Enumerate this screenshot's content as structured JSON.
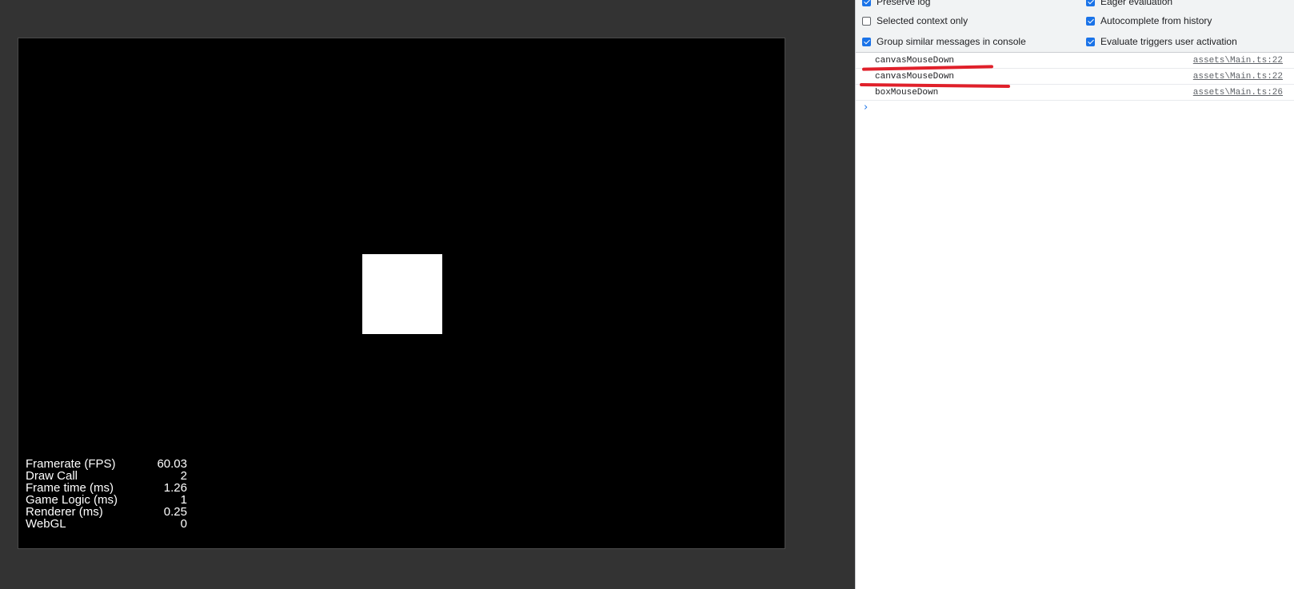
{
  "stats": [
    {
      "label": "Framerate (FPS)",
      "value": "60.03"
    },
    {
      "label": "Draw Call",
      "value": "2"
    },
    {
      "label": "Frame time (ms)",
      "value": "1.26"
    },
    {
      "label": "Game Logic (ms)",
      "value": "1"
    },
    {
      "label": "Renderer (ms)",
      "value": "0.25"
    },
    {
      "label": "WebGL",
      "value": "0"
    }
  ],
  "settings": {
    "preserve_log": {
      "label": "Preserve log",
      "checked": true
    },
    "eager_evaluation": {
      "label": "Eager evaluation",
      "checked": true
    },
    "selected_context_only": {
      "label": "Selected context only",
      "checked": false
    },
    "autocomplete_from_history": {
      "label": "Autocomplete from history",
      "checked": true
    },
    "group_similar": {
      "label": "Group similar messages in console",
      "checked": true
    },
    "evaluate_triggers": {
      "label": "Evaluate triggers user activation",
      "checked": true
    }
  },
  "console": {
    "messages": [
      {
        "text": "canvasMouseDown",
        "source": "assets\\Main.ts:22"
      },
      {
        "text": "canvasMouseDown",
        "source": "assets\\Main.ts:22"
      },
      {
        "text": "boxMouseDown",
        "source": "assets\\Main.ts:26"
      }
    ],
    "prompt_icon": "chevron-right-icon"
  },
  "colors": {
    "page_background": "#333333",
    "canvas_background": "#000000",
    "annotation_red": "#e0202a",
    "checkbox_blue": "#1a73e8"
  }
}
